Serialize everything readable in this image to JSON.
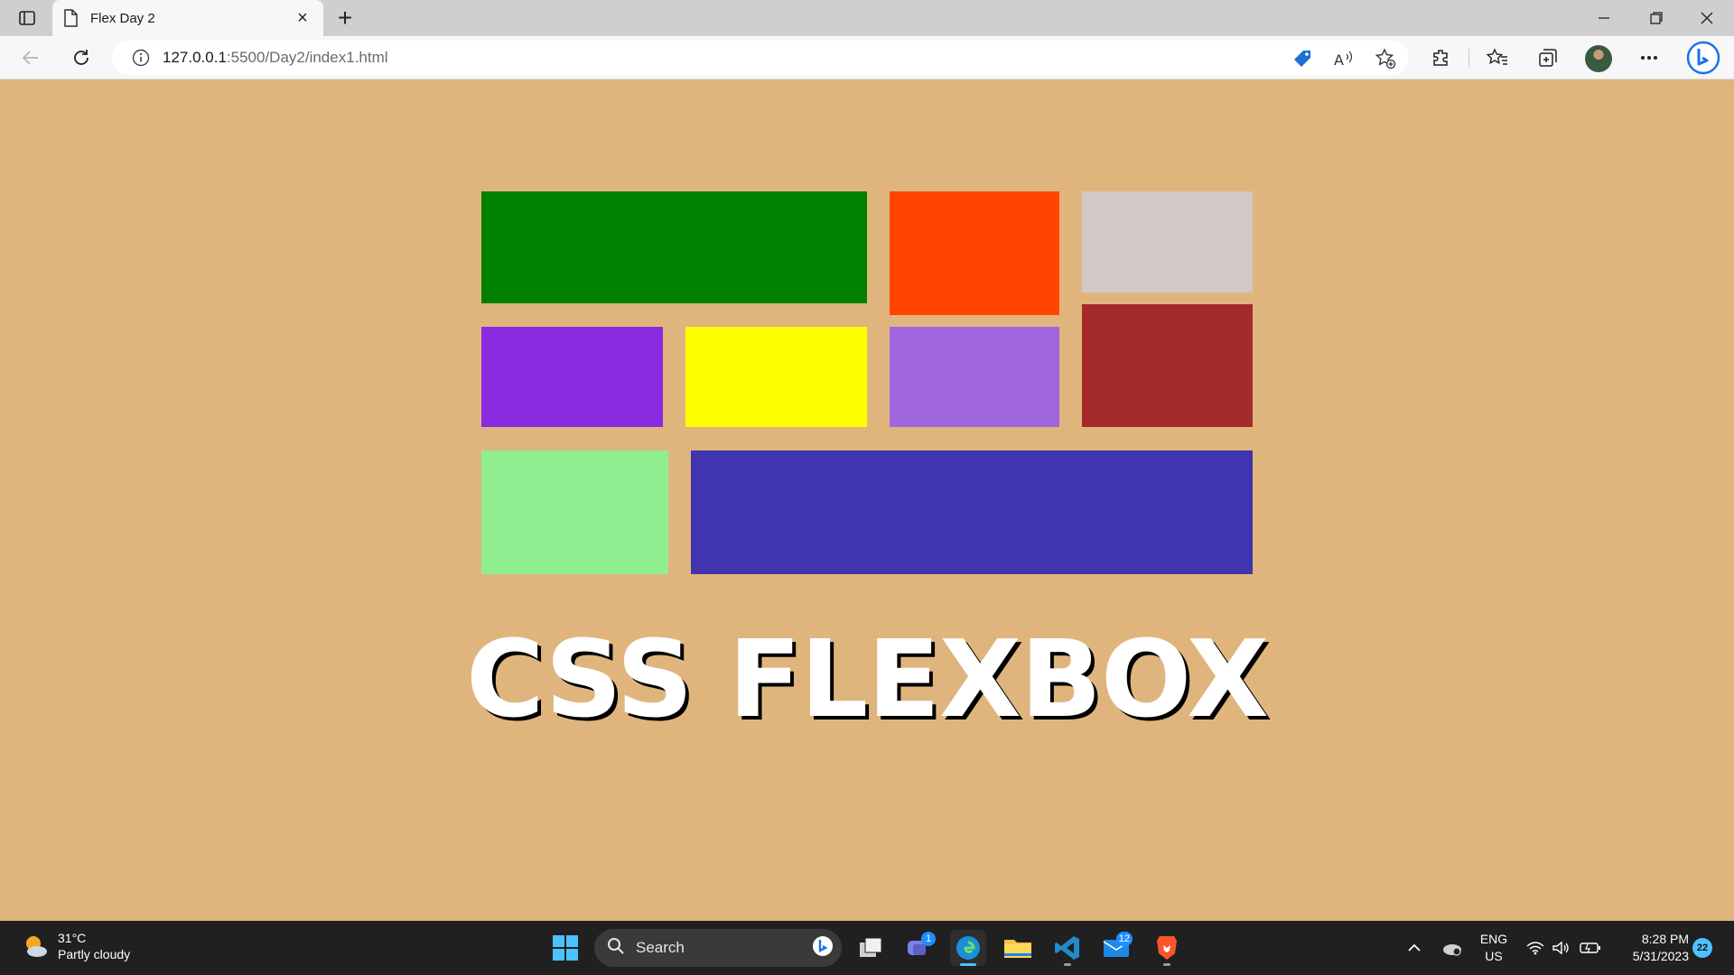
{
  "browser": {
    "tab": {
      "title": "Flex Day 2"
    },
    "address": {
      "host": "127.0.0.1",
      "path": ":5500/Day2/index1.html"
    }
  },
  "page": {
    "heading": "CSS FLEXBOX",
    "boxes": [
      {
        "name": "box-green",
        "color": "#008000"
      },
      {
        "name": "box-orangered",
        "color": "#ff4500"
      },
      {
        "name": "box-lightgray",
        "color": "#d3c8c8"
      },
      {
        "name": "box-blueviolet",
        "color": "#8a2be2"
      },
      {
        "name": "box-yellow",
        "color": "#ffff00"
      },
      {
        "name": "box-mediumpurple",
        "color": "#a066dd"
      },
      {
        "name": "box-brown",
        "color": "#a52a2a"
      },
      {
        "name": "box-lightgreen",
        "color": "#90ee90"
      },
      {
        "name": "box-indigo",
        "color": "#4035ae"
      }
    ],
    "background": "#e0b57d"
  },
  "taskbar": {
    "weather": {
      "temp": "31°C",
      "condition": "Partly cloudy"
    },
    "search_label": "Search",
    "apps": [
      "windows-start",
      "task-view",
      "teams",
      "edge",
      "file-explorer",
      "vscode",
      "mail",
      "brave"
    ],
    "teams_badge": "1",
    "mail_badge": "12",
    "language": {
      "line1": "ENG",
      "line2": "US"
    },
    "clock": {
      "time": "8:28 PM",
      "date": "5/31/2023"
    },
    "notifications": "22"
  }
}
